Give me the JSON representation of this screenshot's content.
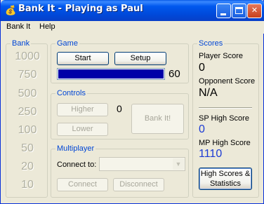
{
  "window": {
    "title": "Bank It - Playing as Paul",
    "icon": "money-bag-icon"
  },
  "menu": {
    "items": [
      "Bank It",
      "Help"
    ]
  },
  "bank": {
    "label": "Bank",
    "values": [
      "1000",
      "750",
      "500",
      "250",
      "100",
      "50",
      "20",
      "10"
    ]
  },
  "game": {
    "label": "Game",
    "start_label": "Start",
    "setup_label": "Setup",
    "timer": "60",
    "progress": 1.0,
    "progress_color": "#0000a8"
  },
  "controls": {
    "label": "Controls",
    "higher_label": "Higher",
    "lower_label": "Lower",
    "value": "0",
    "bank_it_label": "Bank It!"
  },
  "multiplayer": {
    "label": "Multiplayer",
    "connect_to_label": "Connect to:",
    "connect_to_value": "",
    "connect_label": "Connect",
    "disconnect_label": "Disconnect"
  },
  "scores": {
    "label": "Scores",
    "player_score_label": "Player Score",
    "player_score": "0",
    "opponent_score_label": "Opponent Score",
    "opponent_score": "N/A",
    "sp_high_label": "SP High Score",
    "sp_high": "0",
    "mp_high_label": "MP High Score",
    "mp_high": "1110",
    "hs_button_line1": "High Scores &",
    "hs_button_line2": "Statistics"
  },
  "colors": {
    "group_label": "#0046d5",
    "high_score": "#1c3bd4",
    "disabled_text": "#a7a69a"
  }
}
